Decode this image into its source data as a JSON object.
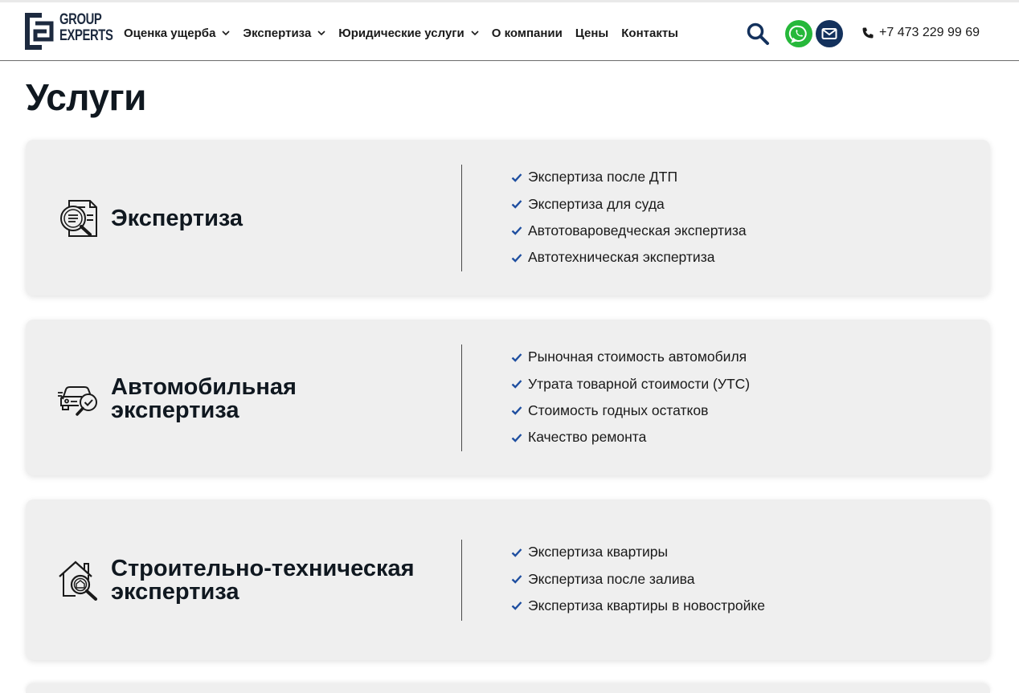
{
  "brand": {
    "line1": "GROUP",
    "line2": "EXPERTS",
    "colors": {
      "navy": "#1d2a3f",
      "accent": "#13315c",
      "whatsapp": "#26b83a",
      "check": "#1f4fa0"
    }
  },
  "nav": [
    {
      "label": "Оценка ущерба",
      "has_dropdown": true
    },
    {
      "label": "Экспертиза",
      "has_dropdown": true
    },
    {
      "label": "Юридические услуги",
      "has_dropdown": true
    },
    {
      "label": "О компании",
      "has_dropdown": false
    },
    {
      "label": "Цены",
      "has_dropdown": false
    },
    {
      "label": "Контакты",
      "has_dropdown": false
    }
  ],
  "header_icons": {
    "search": "search-icon",
    "whatsapp": "whatsapp-icon",
    "mail": "mail-icon",
    "phone": "phone-icon"
  },
  "phone": "+7 473 229 99 69",
  "page_title": "Услуги",
  "cards": [
    {
      "icon": "document-magnifier-icon",
      "title_lines": [
        "Экспертиза"
      ],
      "items": [
        "Экспертиза после ДТП",
        "Экспертиза для суда",
        "Автотовароведческая экспертиза",
        "Автотехническая экспертиза"
      ]
    },
    {
      "icon": "car-check-icon",
      "title_lines": [
        "Автомобильная",
        "экспертиза"
      ],
      "items": [
        "Рыночная стоимость автомобиля",
        "Утрата товарной стоимости (УТС)",
        "Стоимость годных остатков",
        "Качество ремонта"
      ]
    },
    {
      "icon": "house-magnifier-icon",
      "title_lines": [
        "Строительно-техническая",
        "экспертиза"
      ],
      "items": [
        "Экспертиза квартиры",
        "Экспертиза после залива",
        "Экспертиза квартиры в новостройке"
      ]
    }
  ]
}
